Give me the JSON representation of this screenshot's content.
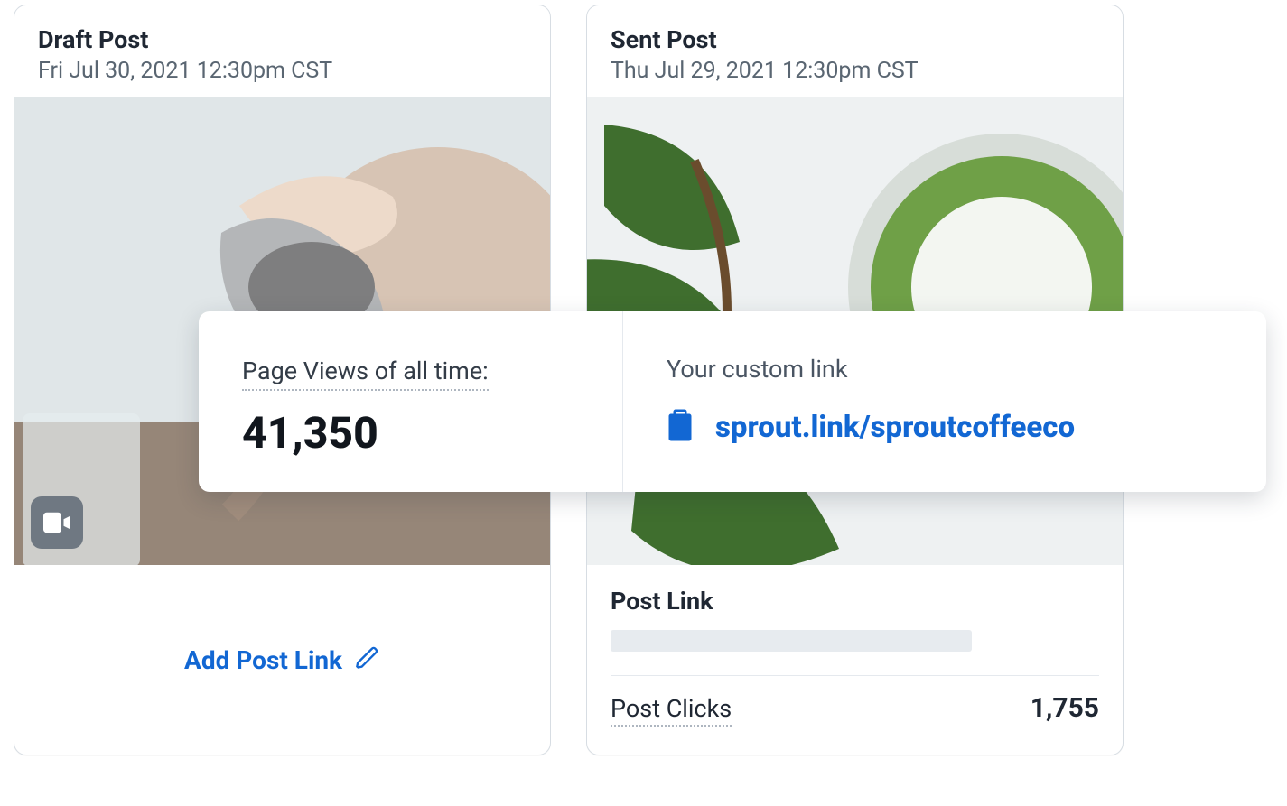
{
  "draft": {
    "title": "Draft Post",
    "date": "Fri Jul 30, 2021 12:30pm CST",
    "add_link_label": "Add Post Link"
  },
  "sent": {
    "title": "Sent Post",
    "date": "Thu Jul 29, 2021 12:30pm CST",
    "postlink_label": "Post Link",
    "clicks_label": "Post Clicks",
    "clicks_value": "1,755"
  },
  "overlay": {
    "page_views_label": "Page Views of all time:",
    "page_views_value": "41,350",
    "custom_link_label": "Your custom link",
    "custom_link_url": "sprout.link/sproutcoffeeco"
  }
}
